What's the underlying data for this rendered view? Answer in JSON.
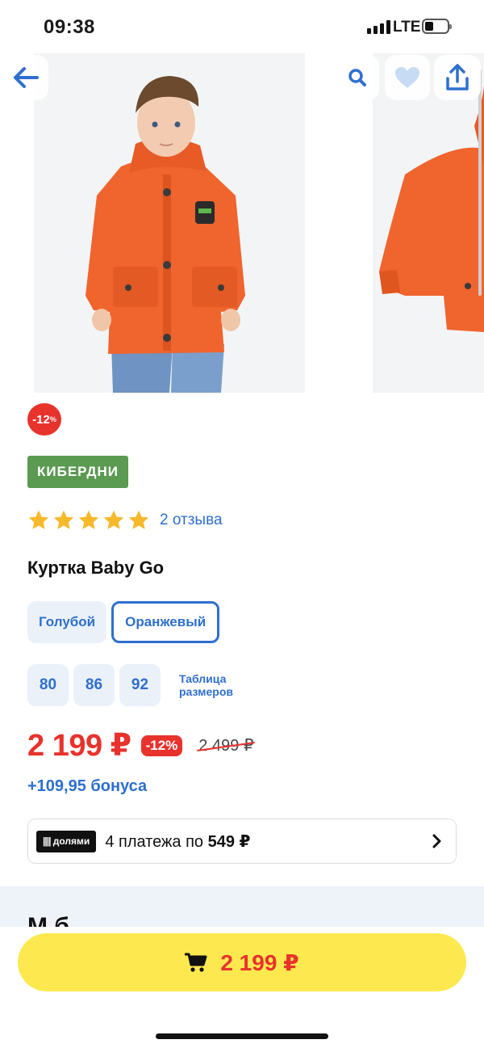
{
  "status_bar": {
    "time": "09:38",
    "network": "LTE"
  },
  "gallery": {
    "image_names": [
      "boy-in-orange-jacket-photo",
      "orange-jacket-side-photo"
    ]
  },
  "nav": {
    "back_icon": "arrow-left-icon",
    "search_icon": "search-icon",
    "favorite_icon": "heart-icon",
    "share_icon": "share-icon"
  },
  "discount": {
    "value": "-12",
    "unit": "%"
  },
  "brand": "КИБЕРДНИ",
  "rating": {
    "stars": 5,
    "reviews": "2 отзыва"
  },
  "product": {
    "title": "Куртка Baby Go"
  },
  "colors": [
    {
      "label": "Голубой",
      "selected": false
    },
    {
      "label": "Оранжевый",
      "selected": true
    }
  ],
  "sizes": [
    "80",
    "86",
    "92"
  ],
  "size_table": "Таблица размеров",
  "price": {
    "current": "2 199 ₽",
    "discount": "-12%",
    "old": "2 499 ₽"
  },
  "bonus": "+109,95 бонуса",
  "dolyami": {
    "logo": "долями",
    "text_prefix": "4 платежа по",
    "amount": "549 ₽"
  },
  "section": {
    "title_partial": "М          б"
  },
  "cart_button": {
    "price": "2 199 ₽",
    "icon": "cart-icon"
  },
  "colors_palette": {
    "accent": "#2e6fce",
    "sale": "#e8322c",
    "brand_green": "#5a9a51",
    "cta": "#fde94f"
  }
}
